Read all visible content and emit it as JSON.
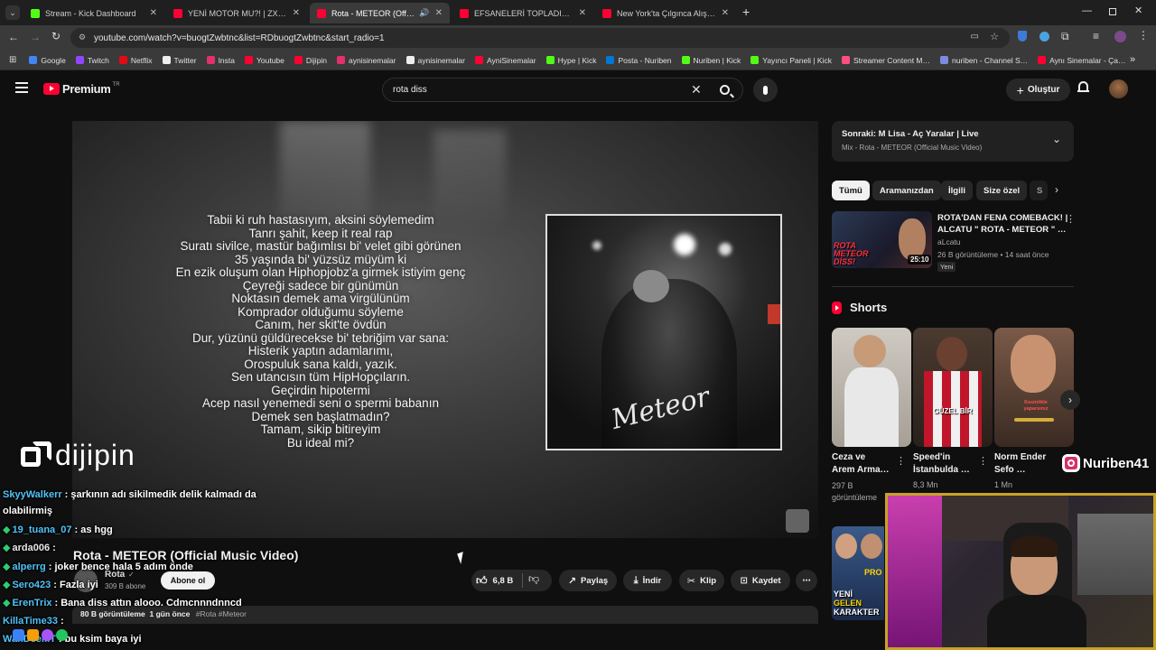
{
  "browser": {
    "tabs": [
      {
        "label": "Stream - Kick Dashboard",
        "color": "#53fc18"
      },
      {
        "label": "YENİ MOTOR MU?! | ZX6R İLK …",
        "color": "#ff0033"
      },
      {
        "label": "Rota - METEOR (Official Mu…",
        "color": "#ff0033"
      },
      {
        "label": "EFSANELERİ TOPLADIM VE DEN…",
        "color": "#ff0033"
      },
      {
        "label": "New York'ta Çılgınca Alışveriş Y…",
        "color": "#ff0033"
      }
    ],
    "new_tab": "+",
    "url": "youtube.com/watch?v=buogtZwbtnc&list=RDbuogtZwbtnc&start_radio=1",
    "bookmarks": [
      {
        "label": "Google",
        "color": "#4285f4"
      },
      {
        "label": "Twitch",
        "color": "#9146ff"
      },
      {
        "label": "Netflix",
        "color": "#e50914"
      },
      {
        "label": "Twitter",
        "color": "#eeeeee"
      },
      {
        "label": "Insta",
        "color": "#e1306c"
      },
      {
        "label": "Youtube",
        "color": "#ff0033"
      },
      {
        "label": "Dijipin",
        "color": "#ff0033"
      },
      {
        "label": "aynisinemalar",
        "color": "#e1306c"
      },
      {
        "label": "aynisinemalar",
        "color": "#eeeeee"
      },
      {
        "label": "AyniSinemalar",
        "color": "#ff0033"
      },
      {
        "label": "Hype | Kick",
        "color": "#53fc18"
      },
      {
        "label": "Posta - Nuriben",
        "color": "#0078d4"
      },
      {
        "label": "Nuriben | Kick",
        "color": "#53fc18"
      },
      {
        "label": "Yayıncı Paneli | Kick",
        "color": "#53fc18"
      },
      {
        "label": "Streamer Content M…",
        "color": "#ff4f81"
      },
      {
        "label": "nuriben - Channel S…",
        "color": "#7b8cde"
      },
      {
        "label": "Aynı Sinemalar - Ça…",
        "color": "#ff0033"
      }
    ],
    "more_bookmarks": "»"
  },
  "yt": {
    "logo": "Premium",
    "region": "TR",
    "search_value": "rota diss",
    "create_label": "Oluştur"
  },
  "lyrics": [
    "Tabii ki ruh hastasıyım, aksini söylemedim",
    "Tanrı şahit, keep it real rap",
    "Suratı sivilce, mastür bağımlısı bi' velet gibi görünen",
    "35 yaşında bi' yüzsüz müyüm ki",
    "En ezik oluşum olan Hiphopjobz'a girmek istiyim genç",
    "Çeyreği sadece bir günümün",
    "Noktasın demek ama virgülünüm",
    "Komprador olduğumu söyleme",
    "Canım, her skit'te övdün",
    "Dur, yüzünü güldürecekse bi' tebriğim var sana:",
    "Histerik yaptın adamlarımı,",
    "Orospuluk sana kaldı, yazık.",
    "Sen utancısın tüm HipHopçıların.",
    "Geçirdin hipotermi",
    "Acep nasıl yenemedi seni o spermi babanın",
    "Demek sen başlatmadın?",
    "Tamam, sikip bitireyim",
    "Bu ideal mi?"
  ],
  "cover_signature": "Meteor",
  "watermark": "dijipin",
  "video": {
    "title": "Rota - METEOR (Official Music Video)",
    "channel": "Rota",
    "subscribers": "309 B abone",
    "subscribe_label": "Abone ol",
    "likes": "6,8 B",
    "share_label": "Paylaş",
    "download_label": "İndir",
    "clip_label": "Klip",
    "save_label": "Kaydet",
    "meta": "80 B görüntüleme  1 gün önce",
    "tags": "#Rota #Meteor"
  },
  "chat": [
    {
      "user": "SkyyWalkerr",
      "text": ": şarkının adı sikilmedik delik kalmadı da"
    },
    {
      "user": "",
      "text": "olabilirmiş"
    },
    {
      "user": "19_tuana_07",
      "text": ": as hgg"
    },
    {
      "user": "arda006",
      "text": ":"
    },
    {
      "user": "alperrg",
      "text": ": joker bence hala 5 adım önde"
    },
    {
      "user": "Sero423",
      "text": ": Fazla iyi"
    },
    {
      "user": "ErenTrix",
      "text": ": Bana diss attın alooo. Cdmcnnndnncd"
    },
    {
      "user": "KillaTime33",
      "text": ":"
    },
    {
      "user": "WahDeeMT",
      "text": ": bu ksim baya iyi"
    }
  ],
  "sidebar": {
    "up_next_title": "Sonraki: M Lisa - Aç Yaralar | Live",
    "up_next_sub": "Mix - Rota - METEOR (Official Music Video)",
    "chips": [
      "Tümü",
      "Aramanızdan",
      "İlgili",
      "Size özel",
      "S"
    ],
    "rec": {
      "title_line1": "ROTA'DAN FENA COMEBACK! |",
      "title_line2": "ALCATU \" ROTA - METEOR \" …",
      "channel": "aLcatu",
      "meta": "26 B görüntüleme • 14 saat önce",
      "badge": "Yeni",
      "duration": "25:10",
      "thumb_text": "ROTA METEOR DİSS!"
    },
    "shorts_heading": "Shorts",
    "shorts": [
      {
        "title1": "Ceza ve",
        "title2": "Arem Arma…",
        "views": "297 B",
        "views2": "görüntüleme"
      },
      {
        "title1": "Speed'in",
        "title2": "İstanbulda …",
        "views": "8,3 Mn",
        "views2": ""
      },
      {
        "title1": "Norm Ender",
        "title2": "Sefo …",
        "views": "1 Mn",
        "views2": ""
      }
    ],
    "short3_caption": "Kesinlikle yaparsınız",
    "short2_caption": "GÜZEL BİR"
  },
  "overlay": {
    "handle": "Nuriben41",
    "bottom_thumb_text1": "YENİ",
    "bottom_thumb_text2": "GELEN",
    "bottom_thumb_text3": "KARAKTER",
    "bottom_thumb_badge": "PRO"
  }
}
